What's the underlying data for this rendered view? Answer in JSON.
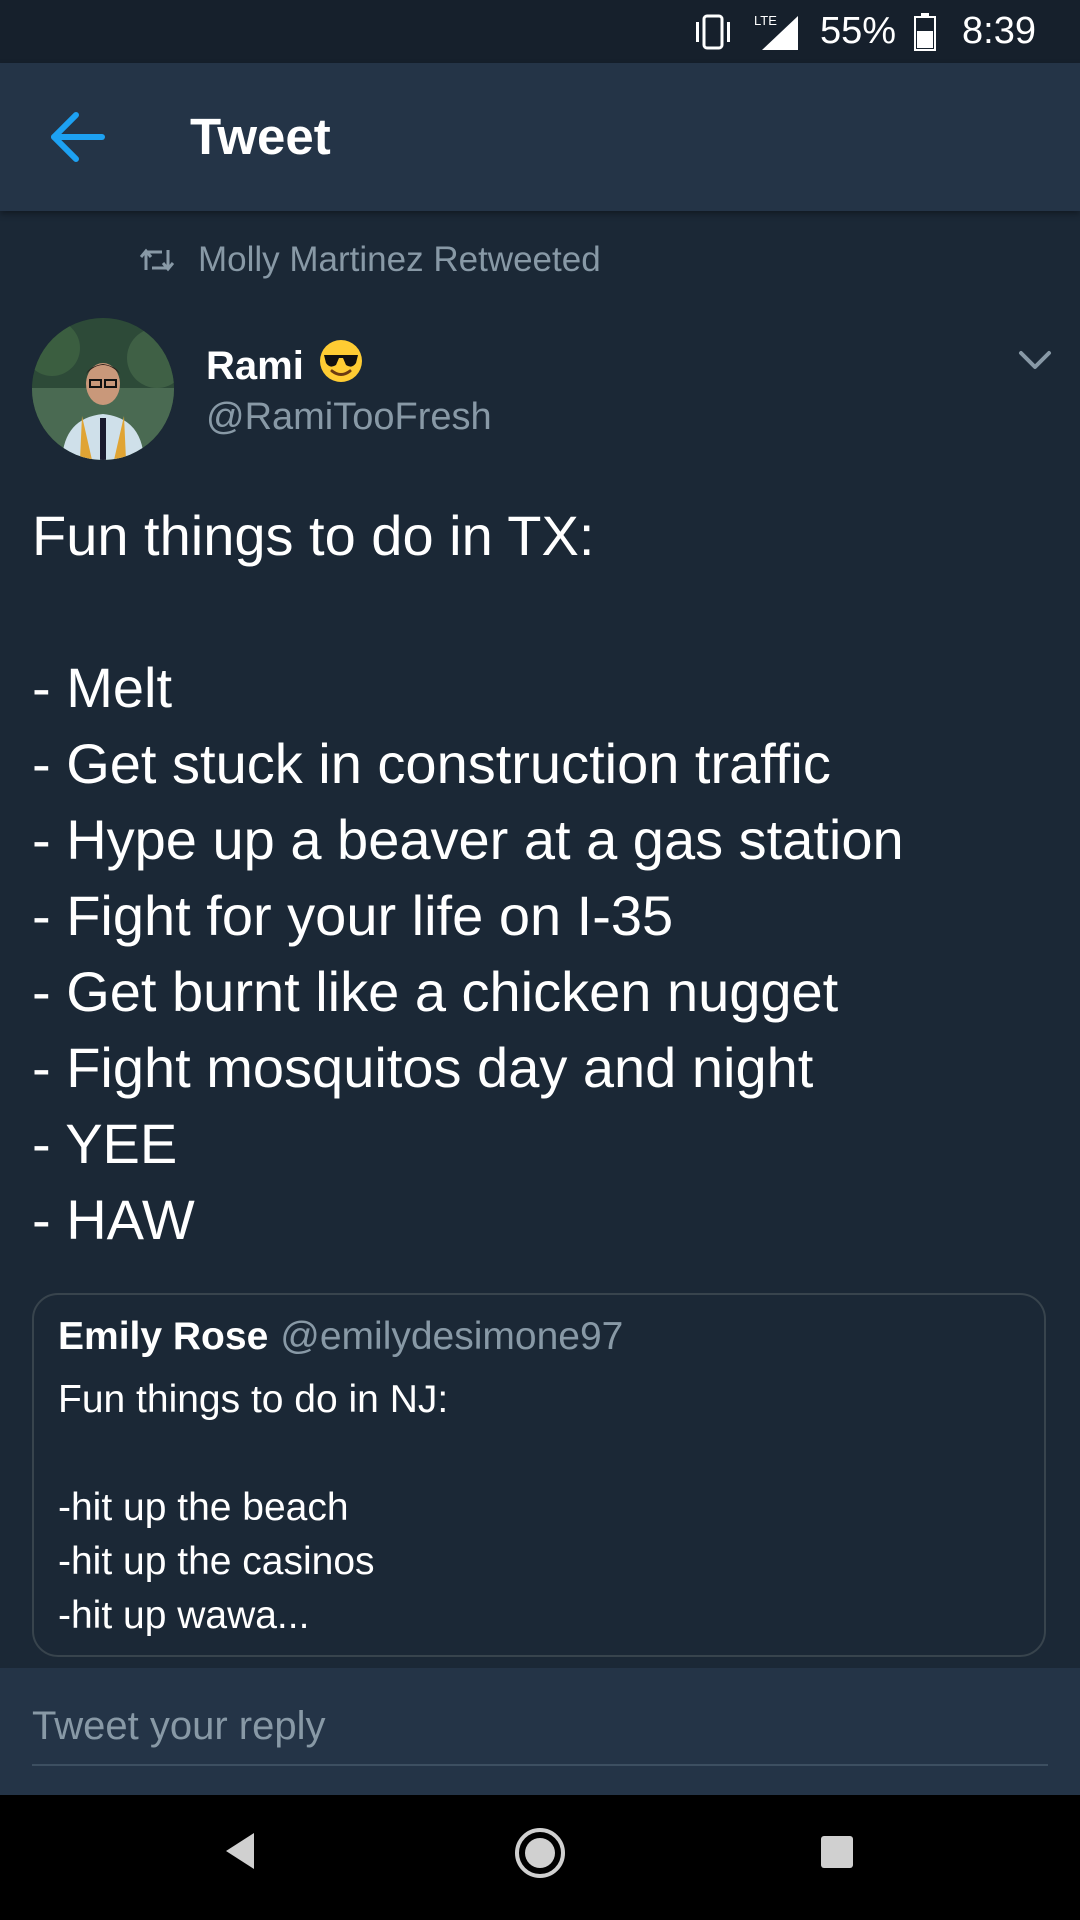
{
  "status_bar": {
    "battery": "55%",
    "time": "8:39",
    "network": "LTE"
  },
  "app_bar": {
    "title": "Tweet"
  },
  "retweet_line": "Molly Martinez Retweeted",
  "tweet": {
    "author_name": "Rami",
    "author_emoji": "😎",
    "author_handle": "@RamiTooFresh",
    "text_lines": [
      "Fun things to do in TX:",
      "",
      "- Melt",
      "- Get stuck in construction traffic",
      "- Hype up a beaver at a gas station",
      "- Fight for your life on I-35",
      "- Get burnt like a chicken nugget",
      "- Fight mosquitos day and night",
      "- YEE",
      "- HAW"
    ]
  },
  "quoted_tweet": {
    "author_name": "Emily Rose",
    "author_handle": "@emilydesimone97",
    "text_lines": [
      "Fun things to do in NJ:",
      "",
      "-hit up the beach",
      "-hit up the casinos",
      "-hit up wawa..."
    ]
  },
  "reply": {
    "placeholder": "Tweet your reply"
  },
  "colors": {
    "background": "#1b2836",
    "app_bar": "#243447",
    "accent": "#1da1f2",
    "secondary_text": "#8899a6"
  },
  "icons": {
    "back": "arrow-left-icon",
    "retweet": "retweet-icon",
    "menu": "chevron-down-icon",
    "nav_back": "triangle-back-icon",
    "nav_home": "circle-home-icon",
    "nav_recents": "square-recents-icon"
  }
}
